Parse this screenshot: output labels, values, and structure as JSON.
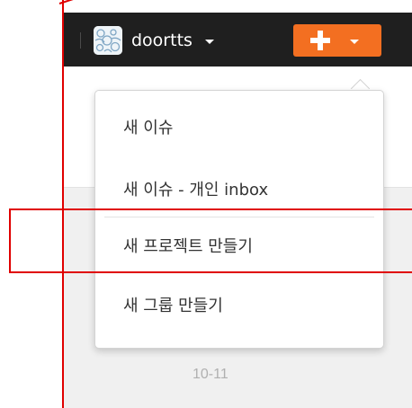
{
  "navbar": {
    "username": "doortts",
    "user_menu_icon": "chevron-down-icon",
    "add_button_icon": "plus-icon",
    "add_button_caret_icon": "chevron-down-icon",
    "accent_color": "#f36f21",
    "bg_color": "#1f1f1f"
  },
  "dropdown": {
    "items": [
      {
        "label": "새 이슈"
      },
      {
        "label": "새 이슈 - 개인 inbox"
      },
      {
        "label": "새 프로젝트 만들기"
      },
      {
        "label": "새 그룹 만들기"
      }
    ]
  },
  "background": {
    "date_label": "10-11"
  },
  "annotation": {
    "highlight_color": "#e00000",
    "highlighted_item": "새 프로젝트 만들기"
  }
}
